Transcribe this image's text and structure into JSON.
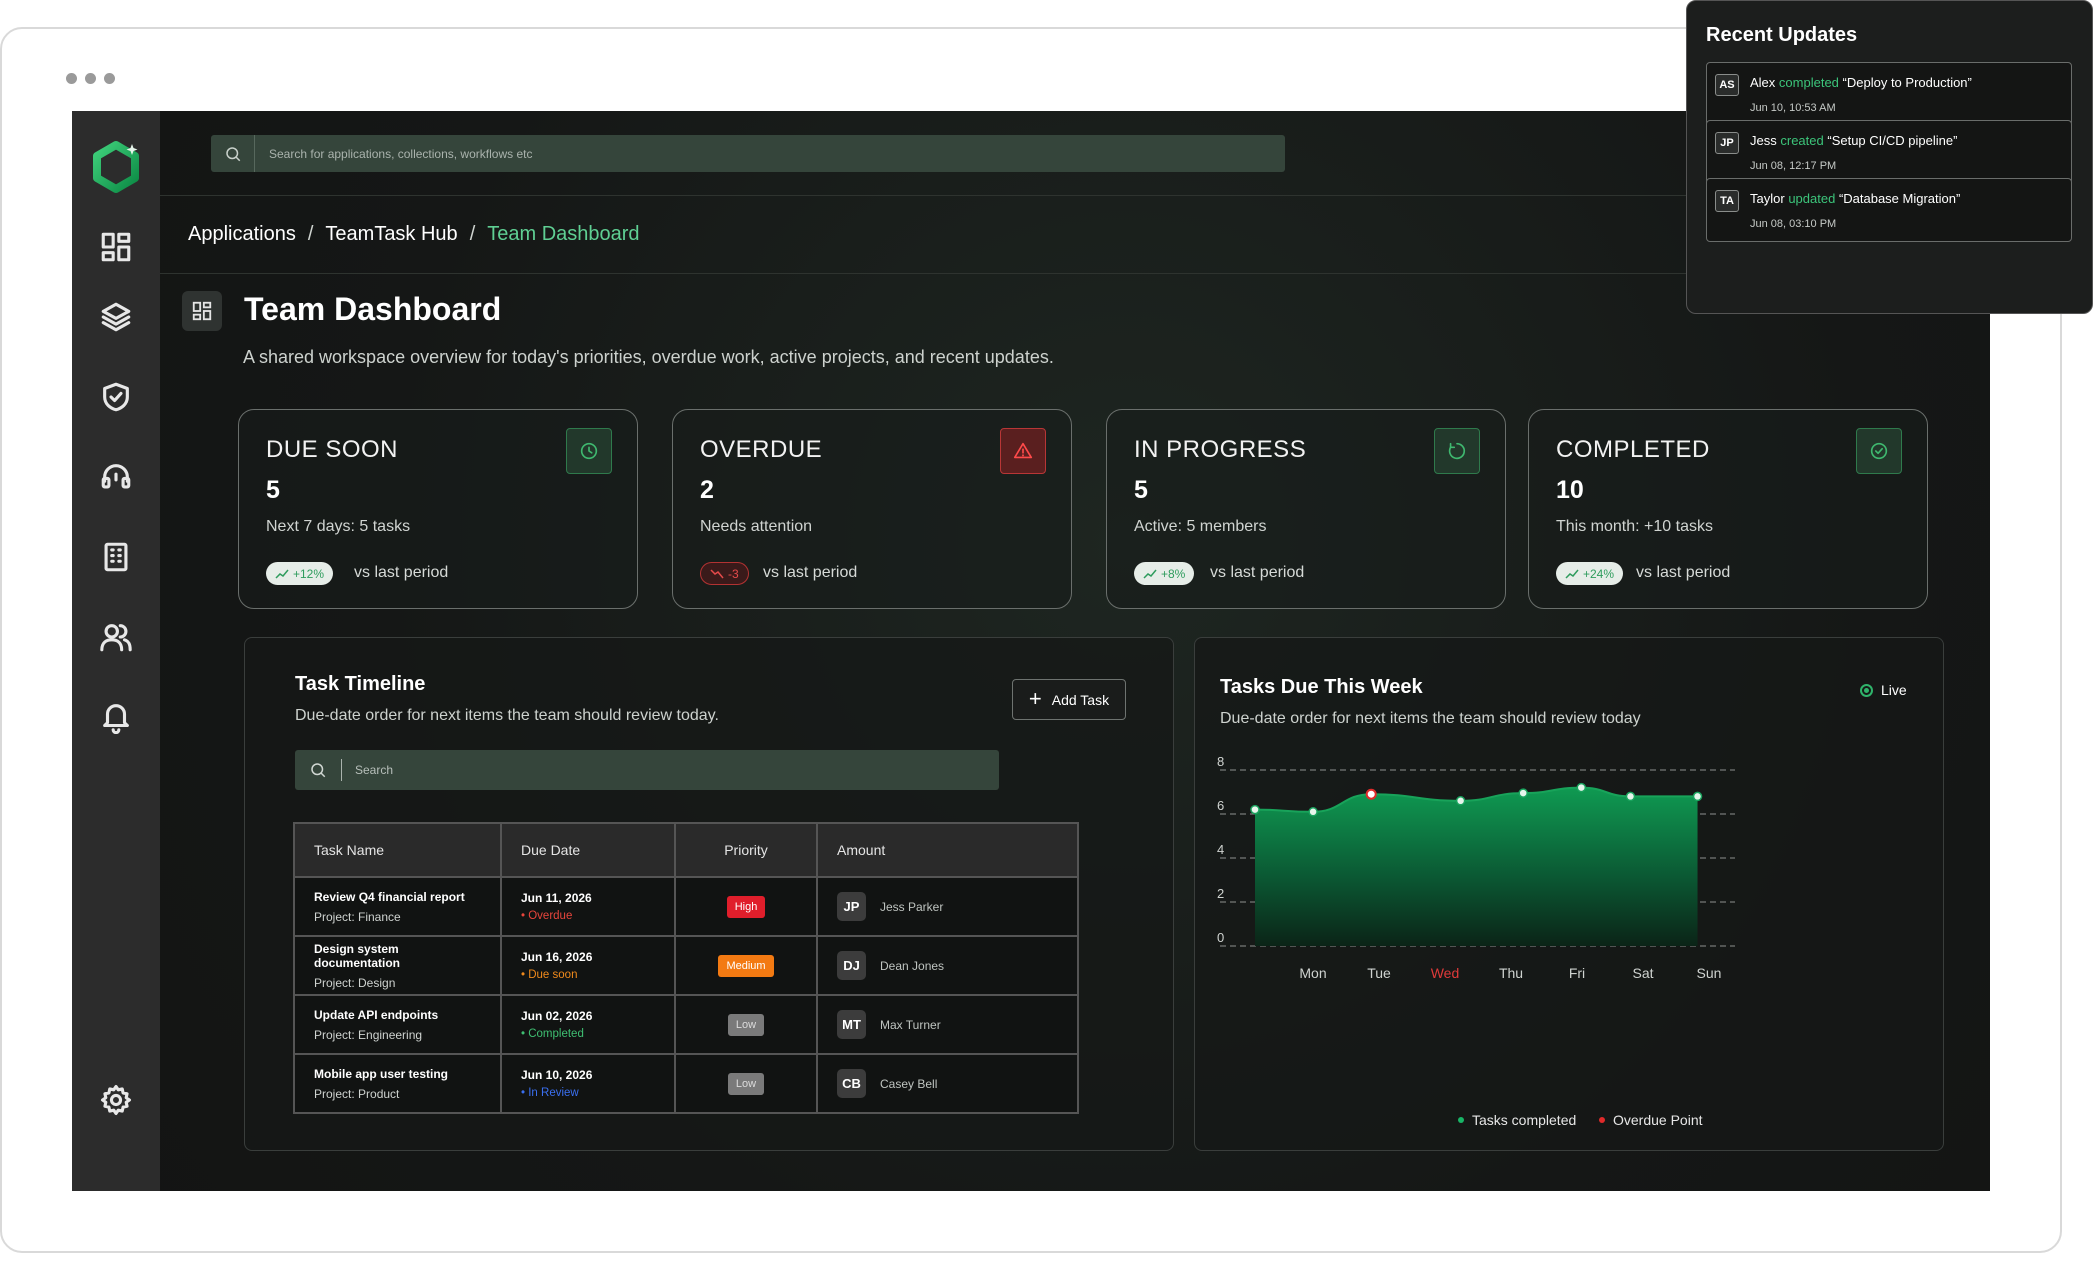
{
  "window": {
    "controls": [
      "dot",
      "dot",
      "dot"
    ]
  },
  "search": {
    "placeholder": "Search for applications, collections, workflows etc"
  },
  "breadcrumb": {
    "items": [
      "Applications",
      "TeamTask Hub",
      "Team Dashboard"
    ],
    "separator": "/"
  },
  "page": {
    "title": "Team Dashboard",
    "subtitle": "A shared workspace overview for today's priorities, overdue work, active projects, and recent updates."
  },
  "sidebar": {
    "items": [
      "dashboard-icon",
      "layers-icon",
      "shield-icon",
      "support-icon",
      "building-icon",
      "users-icon",
      "bell-icon"
    ],
    "footer": "gear-icon"
  },
  "cards": [
    {
      "title": "DUE SOON",
      "value": "5",
      "note": "Next 7 days: 5 tasks",
      "badge": "+12%",
      "trend": "up",
      "vs": "vs last period",
      "icon": "clock-icon",
      "icon_color": "#3fb86f"
    },
    {
      "title": "OVERDUE",
      "value": "2",
      "note": "Needs attention",
      "badge": "-3",
      "trend": "down",
      "vs": "vs last period",
      "icon": "alert-triangle-icon",
      "icon_color": "#e14040"
    },
    {
      "title": "IN PROGRESS",
      "value": "5",
      "note": "Active: 5 members",
      "badge": "+8%",
      "trend": "up",
      "vs": "vs last period",
      "icon": "progress-circle-icon",
      "icon_color": "#3fb86f"
    },
    {
      "title": "COMPLETED",
      "value": "10",
      "note": "This month: +10 tasks",
      "badge": "+24%",
      "trend": "up",
      "vs": "vs last period",
      "icon": "check-circle-icon",
      "icon_color": "#3fb86f"
    }
  ],
  "timeline": {
    "title": "Task Timeline",
    "subtitle": "Due-date order for next items the team should review today.",
    "add_button": "Add Task",
    "search_placeholder": "Search",
    "columns": [
      "Task Name",
      "Due Date",
      "Priority",
      "Amount"
    ],
    "rows": [
      {
        "name": "Review Q4 financial report",
        "project": "Project: Finance",
        "date": "Jun 11, 2026",
        "status": "Overdue",
        "status_color": "#e8453c",
        "priority": "High",
        "priority_class": "high",
        "initials": "JP",
        "assignee": "Jess Parker"
      },
      {
        "name": "Design system documentation",
        "project": "Project: Design",
        "date": "Jun 16, 2026",
        "status": "Due soon",
        "status_color": "#f08a1c",
        "priority": "Medium",
        "priority_class": "medium",
        "initials": "DJ",
        "assignee": "Dean Jones"
      },
      {
        "name": "Update API endpoints",
        "project": "Project: Engineering",
        "date": "Jun 02, 2026",
        "status": "Completed",
        "status_color": "#3fbf72",
        "priority": "Low",
        "priority_class": "low",
        "initials": "MT",
        "assignee": "Max Turner"
      },
      {
        "name": "Mobile app user testing",
        "project": "Project: Product",
        "date": "Jun 10, 2026",
        "status": "In Review",
        "status_color": "#3a6ff0",
        "priority": "Low",
        "priority_class": "low",
        "initials": "CB",
        "assignee": "Casey Bell"
      }
    ]
  },
  "due_week": {
    "title": "Tasks Due This Week",
    "subtitle": "Due-date order for next items the team should review today",
    "live_label": "Live"
  },
  "chart_data": {
    "type": "area",
    "categories": [
      "Mon",
      "Tue",
      "Wed",
      "Thu",
      "Fri",
      "Sat",
      "Sun"
    ],
    "x": [
      0,
      1,
      2,
      3,
      4,
      5,
      6
    ],
    "y_ticks": [
      0,
      2,
      4,
      6,
      8
    ],
    "ylim": [
      0,
      8
    ],
    "grid": true,
    "highlight_category": "Wed",
    "series": [
      {
        "name": "Tasks completed",
        "x": [
          0,
          0.65,
          1.3,
          2.3,
          3,
          3.65,
          4.2,
          4.95
        ],
        "values": [
          6.2,
          6.1,
          6.9,
          6.6,
          6.95,
          7.2,
          6.8,
          6.8
        ],
        "color": "#0fa356"
      }
    ],
    "overdue_points": [
      {
        "x": 1.3,
        "value": 6.9,
        "name": "Overdue Point",
        "color": "#e02a2a"
      }
    ],
    "legend": [
      {
        "label": "Tasks completed",
        "color": "#18b566"
      },
      {
        "label": "Overdue Point",
        "color": "#e02a2a"
      }
    ],
    "legend_position": "bottom"
  },
  "updates": {
    "title": "Recent Updates",
    "items": [
      {
        "initials": "AS",
        "user": "Alex",
        "action": "completed",
        "target": "“Deploy to Production”",
        "time": "Jun 10, 10:53 AM"
      },
      {
        "initials": "JP",
        "user": "Jess",
        "action": "created",
        "target": "“Setup CI/CD pipeline”",
        "time": "Jun 08, 12:17 PM"
      },
      {
        "initials": "TA",
        "user": "Taylor",
        "action": "updated",
        "target": "“Database Migration”",
        "time": "Jun 08, 03:10 PM"
      }
    ]
  }
}
